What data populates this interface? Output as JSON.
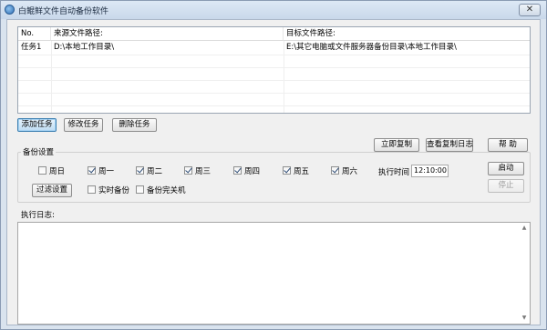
{
  "window": {
    "title": "白鲲鲜文件自动备份软件",
    "close_label": "✕"
  },
  "table": {
    "headers": [
      "No.",
      "来源文件路径:",
      "目标文件路径:"
    ],
    "rows": [
      {
        "no": "任务1",
        "source": "D:\\本地工作目录\\",
        "target": "E:\\其它电脑或文件服务器备份目录\\本地工作目录\\"
      }
    ]
  },
  "task_buttons": {
    "add": "添加任务",
    "edit": "修改任务",
    "delete": "删除任务"
  },
  "action_buttons": {
    "copy_now": "立即复制",
    "view_log": "查看复制日志",
    "help": "帮 助"
  },
  "backup": {
    "group_label": "备份设置",
    "days": [
      {
        "label": "周日",
        "checked": false
      },
      {
        "label": "周一",
        "checked": true
      },
      {
        "label": "周二",
        "checked": true
      },
      {
        "label": "周三",
        "checked": true
      },
      {
        "label": "周四",
        "checked": true
      },
      {
        "label": "周五",
        "checked": true
      },
      {
        "label": "周六",
        "checked": true
      }
    ],
    "exec_time_label": "执行时间",
    "exec_time_value": "12:10:00",
    "start": "启动",
    "stop": "停止",
    "filter": "过滤设置",
    "realtime": "实时备份",
    "shutdown": "备份完关机"
  },
  "log": {
    "label": "执行日志:",
    "scroll_up": "▲",
    "scroll_down": "▼"
  }
}
